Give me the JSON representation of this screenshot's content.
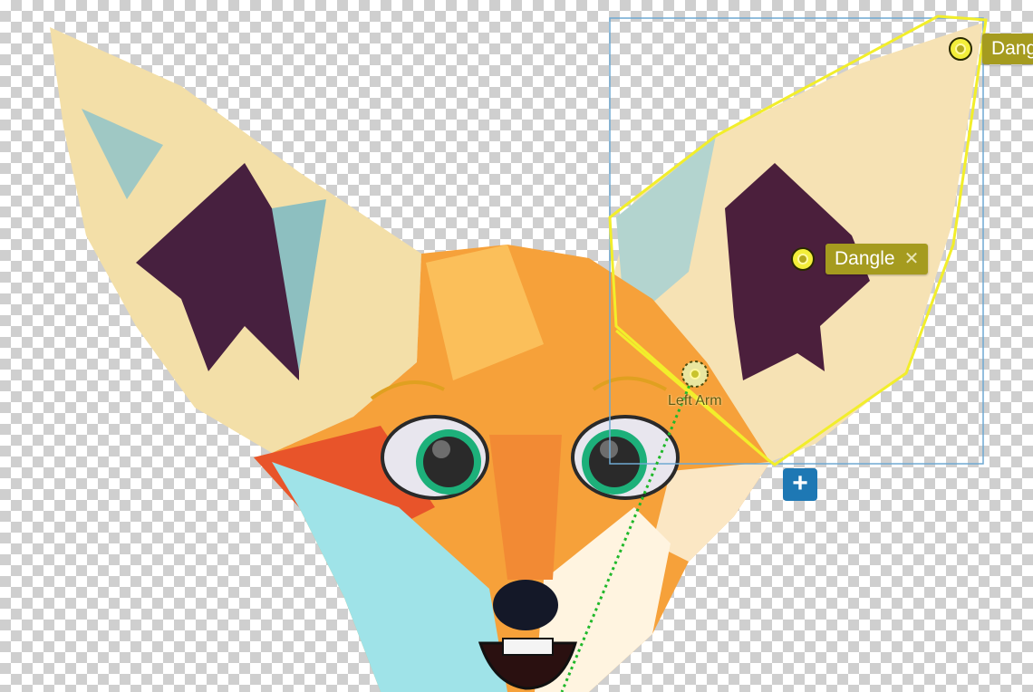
{
  "tags": [
    {
      "label": "Dangle",
      "close": "✕"
    },
    {
      "label": "Dang"
    }
  ],
  "handle": {
    "label": "Left Arm"
  },
  "add_button": {
    "label": "+"
  },
  "colors": {
    "selection_outline": "#f2ee2b",
    "bounding_box": "#6fa9d2",
    "tag_bg": "#a59b1f",
    "add_button": "#1e78b4",
    "connector": "#1fb82a"
  }
}
